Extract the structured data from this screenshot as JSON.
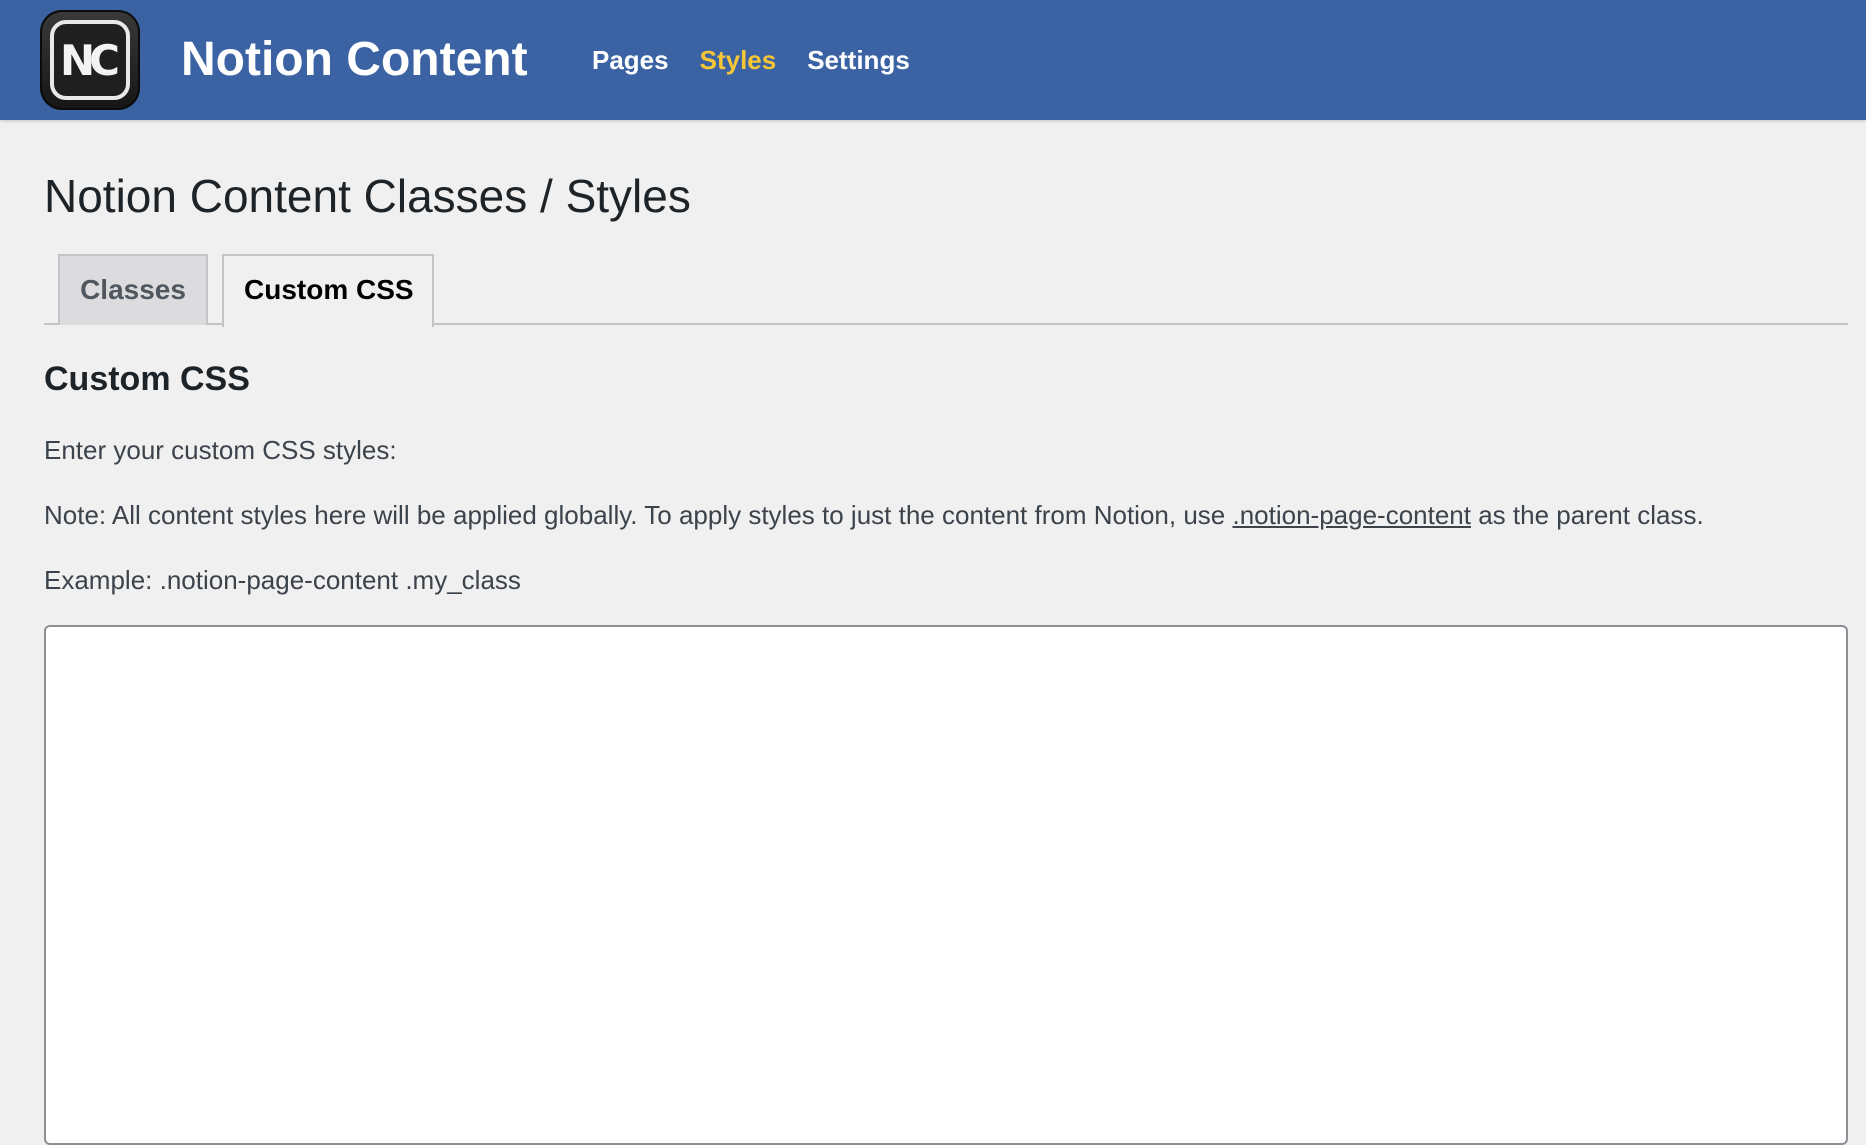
{
  "header": {
    "logo_text": "NC",
    "brand_title": "Notion Content",
    "nav": [
      {
        "label": "Pages",
        "active": false
      },
      {
        "label": "Styles",
        "active": true
      },
      {
        "label": "Settings",
        "active": false
      }
    ],
    "colors": {
      "header_bg": "#3b63a3",
      "nav_active": "#f6c636"
    }
  },
  "page": {
    "title": "Notion Content Classes / Styles",
    "tabs": [
      {
        "label": "Classes",
        "active": false
      },
      {
        "label": "Custom CSS",
        "active": true
      }
    ],
    "section_title": "Custom CSS",
    "intro": "Enter your custom CSS styles:",
    "note_before": "Note: All content styles here will be applied globally. To apply styles to just the content from Notion, use ",
    "note_link": ".notion-page-content",
    "note_after": " as the parent class.",
    "example": "Example: .notion-page-content .my_class",
    "editor_value": ""
  }
}
